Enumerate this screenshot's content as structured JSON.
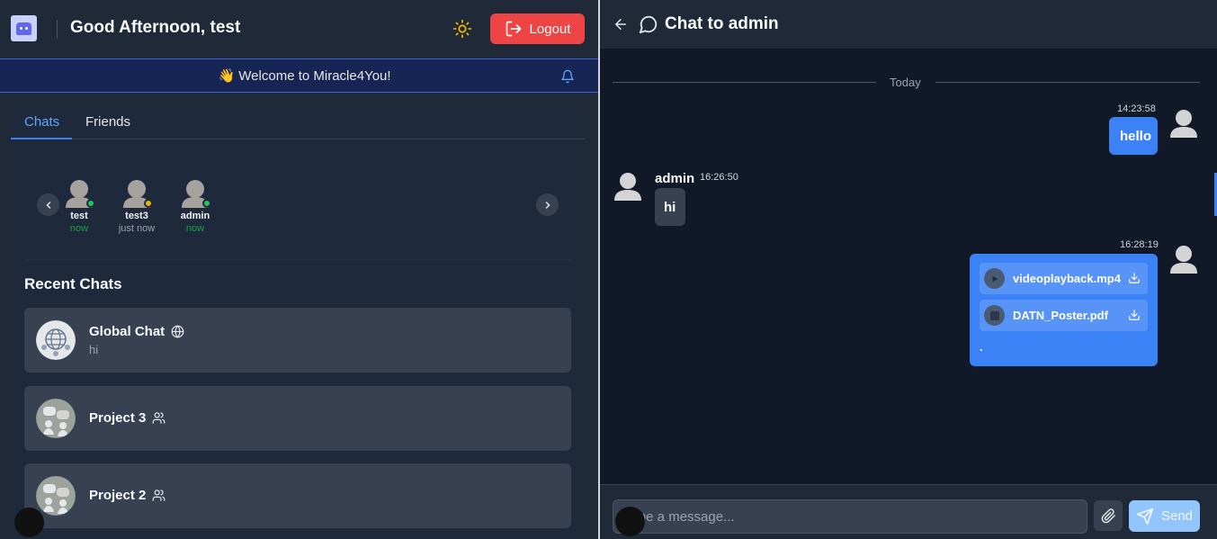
{
  "header": {
    "greeting": "Good Afternoon, test",
    "logout_label": "Logout",
    "theme_icon": "sun-icon"
  },
  "banner": {
    "text": "👋 Welcome to Miracle4You!",
    "icon": "bell-icon"
  },
  "tabs": [
    {
      "label": "Chats",
      "active": true
    },
    {
      "label": "Friends",
      "active": false
    }
  ],
  "friends": [
    {
      "name": "test",
      "status": "now",
      "status_color": "#16a34a",
      "dot_color": "#22c55e"
    },
    {
      "name": "test3",
      "status": "just now",
      "status_color": "#9ca3af",
      "dot_color": "#eab308"
    },
    {
      "name": "admin",
      "status": "now",
      "status_color": "#16a34a",
      "dot_color": "#22c55e"
    }
  ],
  "recent": {
    "title": "Recent Chats",
    "items": [
      {
        "name": "Global Chat",
        "preview": "hi",
        "icon": "globe-icon"
      },
      {
        "name": "Project 3",
        "preview": "",
        "icon": "users-icon"
      },
      {
        "name": "Project 2",
        "preview": "",
        "icon": "users-icon"
      }
    ]
  },
  "chat": {
    "title": "Chat to admin",
    "date_separator": "Today",
    "messages": [
      {
        "direction": "out",
        "time": "14:23:58",
        "text": "hello"
      },
      {
        "direction": "in",
        "sender": "admin",
        "time": "16:26:50",
        "text": "hi"
      },
      {
        "direction": "out",
        "time": "16:28:19",
        "files": [
          "videoplayback.mp4",
          "DATN_Poster.pdf"
        ],
        "text": "."
      }
    ],
    "input_placeholder": "Type a message...",
    "send_label": "Send"
  },
  "colors": {
    "accent": "#3b82f6",
    "logout": "#ef4444",
    "online": "#22c55e",
    "away": "#eab308"
  }
}
